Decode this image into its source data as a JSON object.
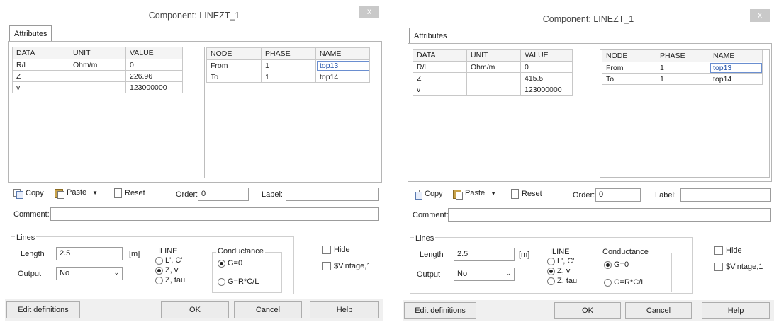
{
  "dialogs": [
    {
      "title": "Component: LINEZT_1",
      "tab": "Attributes",
      "attr_headers": [
        "DATA",
        "UNIT",
        "VALUE"
      ],
      "attr_rows": [
        [
          "R/l",
          "Ohm/m",
          "0"
        ],
        [
          "Z",
          "",
          "226.96"
        ],
        [
          "v",
          "",
          "123000000"
        ]
      ],
      "node_headers": [
        "NODE",
        "PHASE",
        "NAME"
      ],
      "node_rows": [
        [
          "From",
          "1",
          "top13"
        ],
        [
          "To",
          "1",
          "top14"
        ]
      ],
      "toolbar": {
        "copy": "Copy",
        "paste": "Paste",
        "reset": "Reset",
        "order_label": "Order:",
        "order_value": "0",
        "label_label": "Label:",
        "label_value": ""
      },
      "comment_label": "Comment:",
      "comment_value": "",
      "lines": {
        "group": "Lines",
        "length_label": "Length",
        "length_value": "2.5",
        "length_unit": "[m]",
        "output_label": "Output",
        "output_value": "No"
      },
      "iline": {
        "title": "ILINE",
        "options": [
          "L', C'",
          "Z, v",
          "Z, tau"
        ],
        "selected": 1
      },
      "conductance": {
        "title": "Conductance",
        "options": [
          "G=0",
          "G=R*C/L"
        ],
        "selected": 0
      },
      "hide_label": "Hide",
      "vintage_label": "$Vintage,1",
      "buttons": {
        "edit": "Edit definitions",
        "ok": "OK",
        "cancel": "Cancel",
        "help": "Help"
      },
      "close": "x"
    },
    {
      "title": "Component: LINEZT_1",
      "tab": "Attributes",
      "attr_headers": [
        "DATA",
        "UNIT",
        "VALUE"
      ],
      "attr_rows": [
        [
          "R/l",
          "Ohm/m",
          "0"
        ],
        [
          "Z",
          "",
          "415.5"
        ],
        [
          "v",
          "",
          "123000000"
        ]
      ],
      "node_headers": [
        "NODE",
        "PHASE",
        "NAME"
      ],
      "node_rows": [
        [
          "From",
          "1",
          "top13"
        ],
        [
          "To",
          "1",
          "top14"
        ]
      ],
      "toolbar": {
        "copy": "Copy",
        "paste": "Paste",
        "reset": "Reset",
        "order_label": "Order:",
        "order_value": "0",
        "label_label": "Label:",
        "label_value": ""
      },
      "comment_label": "Comment:",
      "comment_value": "",
      "lines": {
        "group": "Lines",
        "length_label": "Length",
        "length_value": "2.5",
        "length_unit": "[m]",
        "output_label": "Output",
        "output_value": "No"
      },
      "iline": {
        "title": "ILINE",
        "options": [
          "L', C'",
          "Z, v",
          "Z, tau"
        ],
        "selected": 1
      },
      "conductance": {
        "title": "Conductance",
        "options": [
          "G=0",
          "G=R*C/L"
        ],
        "selected": 0
      },
      "hide_label": "Hide",
      "vintage_label": "$Vintage,1",
      "buttons": {
        "edit": "Edit definitions",
        "ok": "OK",
        "cancel": "Cancel",
        "help": "Help"
      },
      "close": "x"
    }
  ]
}
